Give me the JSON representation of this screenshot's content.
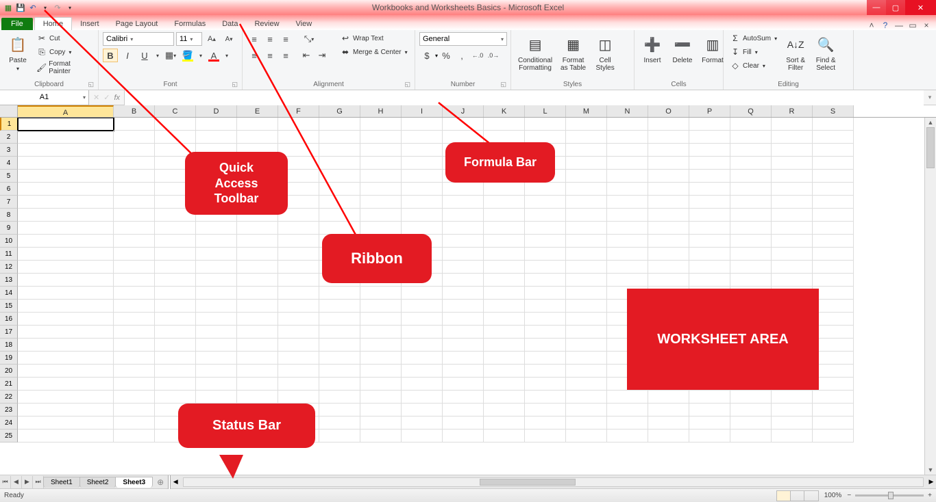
{
  "window": {
    "title": "Workbooks and Worksheets Basics - Microsoft Excel"
  },
  "qat": {
    "save": "💾",
    "undo": "↶",
    "redo": "↷",
    "customize": "▾"
  },
  "win": {
    "min": "—",
    "max": "▢",
    "close": "✕"
  },
  "tabs": {
    "file": "File",
    "items": [
      "Home",
      "Insert",
      "Page Layout",
      "Formulas",
      "Data",
      "Review",
      "View"
    ],
    "active": "Home",
    "help_icons": {
      "minimize_ribbon": "˄",
      "help": "?",
      "mdi_min": "—",
      "mdi_restore": "▭",
      "mdi_close": "×"
    }
  },
  "ribbon": {
    "clipboard": {
      "label": "Clipboard",
      "paste": "Paste",
      "cut": "Cut",
      "copy": "Copy",
      "format_painter": "Format Painter"
    },
    "font": {
      "label": "Font",
      "name": "Calibri",
      "size": "11",
      "grow": "A▴",
      "shrink": "A▾",
      "bold": "B",
      "italic": "I",
      "underline": "U"
    },
    "alignment": {
      "label": "Alignment",
      "wrap": "Wrap Text",
      "merge": "Merge & Center"
    },
    "number": {
      "label": "Number",
      "format": "General",
      "currency": "$",
      "percent": "%",
      "comma": ",",
      "inc": ".00→.0",
      "dec": ".0→.00"
    },
    "styles": {
      "label": "Styles",
      "cond": "Conditional\nFormatting",
      "table": "Format\nas Table",
      "cell": "Cell\nStyles"
    },
    "cells": {
      "label": "Cells",
      "insert": "Insert",
      "delete": "Delete",
      "format": "Format"
    },
    "editing": {
      "label": "Editing",
      "autosum": "AutoSum",
      "fill": "Fill",
      "clear": "Clear",
      "sort": "Sort &\nFilter",
      "find": "Find &\nSelect"
    }
  },
  "namebox": {
    "value": "A1",
    "fx": "fx"
  },
  "columns": [
    "A",
    "B",
    "C",
    "D",
    "E",
    "F",
    "G",
    "H",
    "I",
    "J",
    "K",
    "L",
    "M",
    "N",
    "O",
    "P",
    "Q",
    "R",
    "S"
  ],
  "rows": [
    1,
    2,
    3,
    4,
    5,
    6,
    7,
    8,
    9,
    10,
    11,
    12,
    13,
    14,
    15,
    16,
    17,
    18,
    19,
    20,
    21,
    22,
    23,
    24,
    25
  ],
  "active_cell": "A1",
  "sheets": {
    "nav": {
      "first": "⏮",
      "prev": "◀",
      "next": "▶",
      "last": "⏭"
    },
    "tabs": [
      "Sheet1",
      "Sheet2",
      "Sheet3"
    ],
    "active": "Sheet3",
    "new": "⊕"
  },
  "status": {
    "ready": "Ready",
    "zoom": "100%",
    "minus": "−",
    "plus": "+"
  },
  "callouts": {
    "qat": "Quick\nAccess\nToolbar",
    "ribbon": "Ribbon",
    "formula": "Formula Bar",
    "status": "Status Bar",
    "worksheet": "WORKSHEET AREA"
  }
}
